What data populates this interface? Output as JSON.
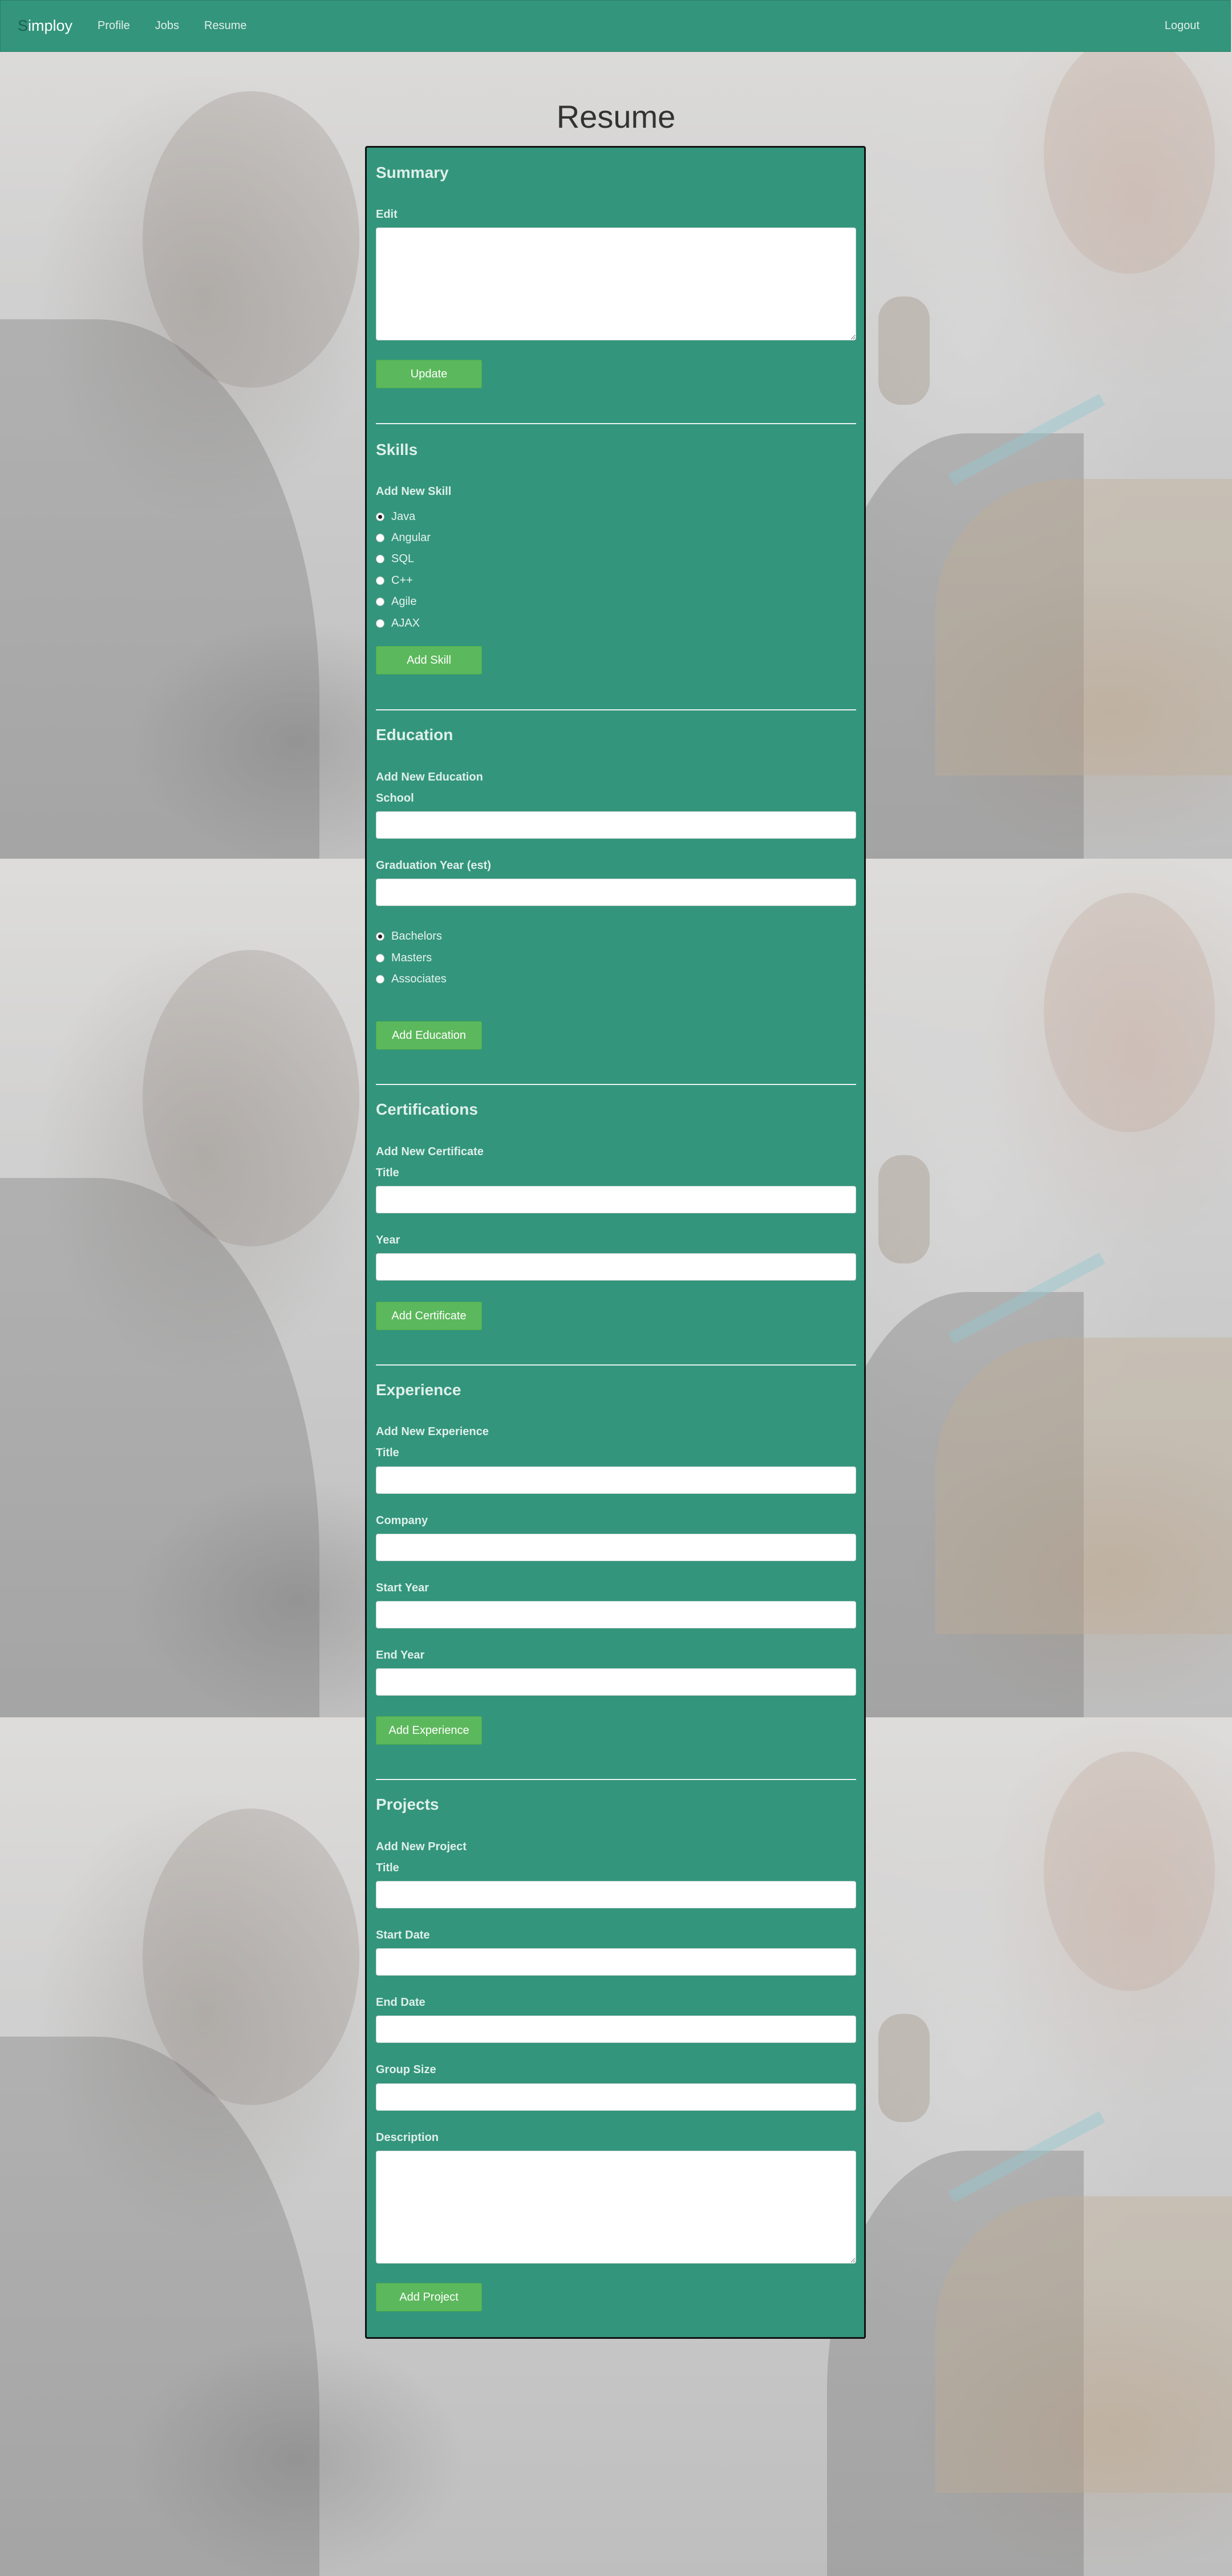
{
  "navbar": {
    "brand_first": "S",
    "brand_rest": "imploy",
    "links": [
      "Profile",
      "Jobs",
      "Resume"
    ],
    "logout": "Logout"
  },
  "page": {
    "title": "Resume"
  },
  "summary": {
    "heading": "Summary",
    "edit_label": "Edit",
    "edit_value": "",
    "button": "Update"
  },
  "skills": {
    "heading": "Skills",
    "add_label": "Add New Skill",
    "options": [
      "Java",
      "Angular",
      "SQL",
      "C++",
      "Agile",
      "AJAX"
    ],
    "selected": "Java",
    "button": "Add Skill"
  },
  "education": {
    "heading": "Education",
    "add_label": "Add New Education",
    "school_label": "School",
    "school_value": "",
    "grad_label": "Graduation Year (est)",
    "grad_value": "",
    "degrees": [
      "Bachelors",
      "Masters",
      "Associates"
    ],
    "selected": "Bachelors",
    "button": "Add Education"
  },
  "certifications": {
    "heading": "Certifications",
    "add_label": "Add New Certificate",
    "title_label": "Title",
    "title_value": "",
    "year_label": "Year",
    "year_value": "",
    "button": "Add Certificate"
  },
  "experience": {
    "heading": "Experience",
    "add_label": "Add New Experience",
    "title_label": "Title",
    "company_label": "Company",
    "start_label": "Start Year",
    "end_label": "End Year",
    "button": "Add Experience"
  },
  "projects": {
    "heading": "Projects",
    "add_label": "Add New Project",
    "title_label": "Title",
    "start_label": "Start Date",
    "end_label": "End Date",
    "group_label": "Group Size",
    "description_label": "Description",
    "button": "Add Project"
  },
  "colors": {
    "navbar": "#33957c",
    "panel": "#33957c",
    "button": "#5cb85c"
  }
}
